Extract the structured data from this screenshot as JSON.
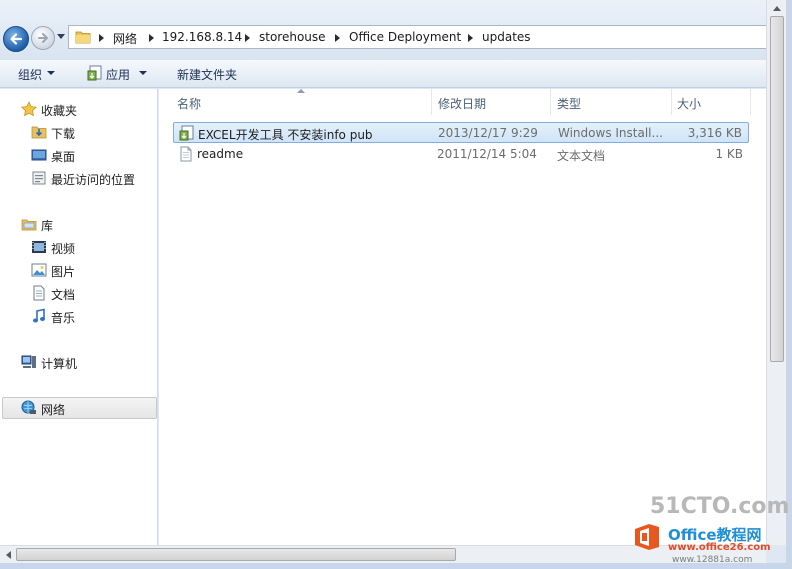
{
  "breadcrumb": [
    "网络",
    "192.168.8.14",
    "storehouse",
    "Office Deployment",
    "updates"
  ],
  "toolbar": {
    "organize": "组织",
    "open_with": "应用",
    "new_folder": "新建文件夹"
  },
  "nav": {
    "favorites": {
      "label": "收藏夹",
      "items": [
        "下载",
        "桌面",
        "最近访问的位置"
      ]
    },
    "libraries": {
      "label": "库",
      "items": [
        "视频",
        "图片",
        "文档",
        "音乐"
      ]
    },
    "computer": "计算机",
    "network": "网络"
  },
  "columns": {
    "name": "名称",
    "modified": "修改日期",
    "type": "类型",
    "size": "大小"
  },
  "files": [
    {
      "name": "EXCEL开发工具 不安装info pub",
      "modified": "2013/12/17 9:29",
      "type": "Windows Install...",
      "size": "3,316 KB",
      "icon": "msi-installer-icon",
      "selected": true
    },
    {
      "name": "readme",
      "modified": "2011/12/14 5:04",
      "type": "文本文档",
      "size": "1 KB",
      "icon": "text-document-icon",
      "selected": false
    }
  ],
  "watermark": {
    "site": "51CTO.com",
    "brand": "Office教程网",
    "url": "www.office26.com",
    "url2": "www.12881a.com"
  },
  "colors": {
    "selection": "#cfe4f8",
    "selection_border": "#84acdd",
    "accent": "#1d5ea8"
  }
}
